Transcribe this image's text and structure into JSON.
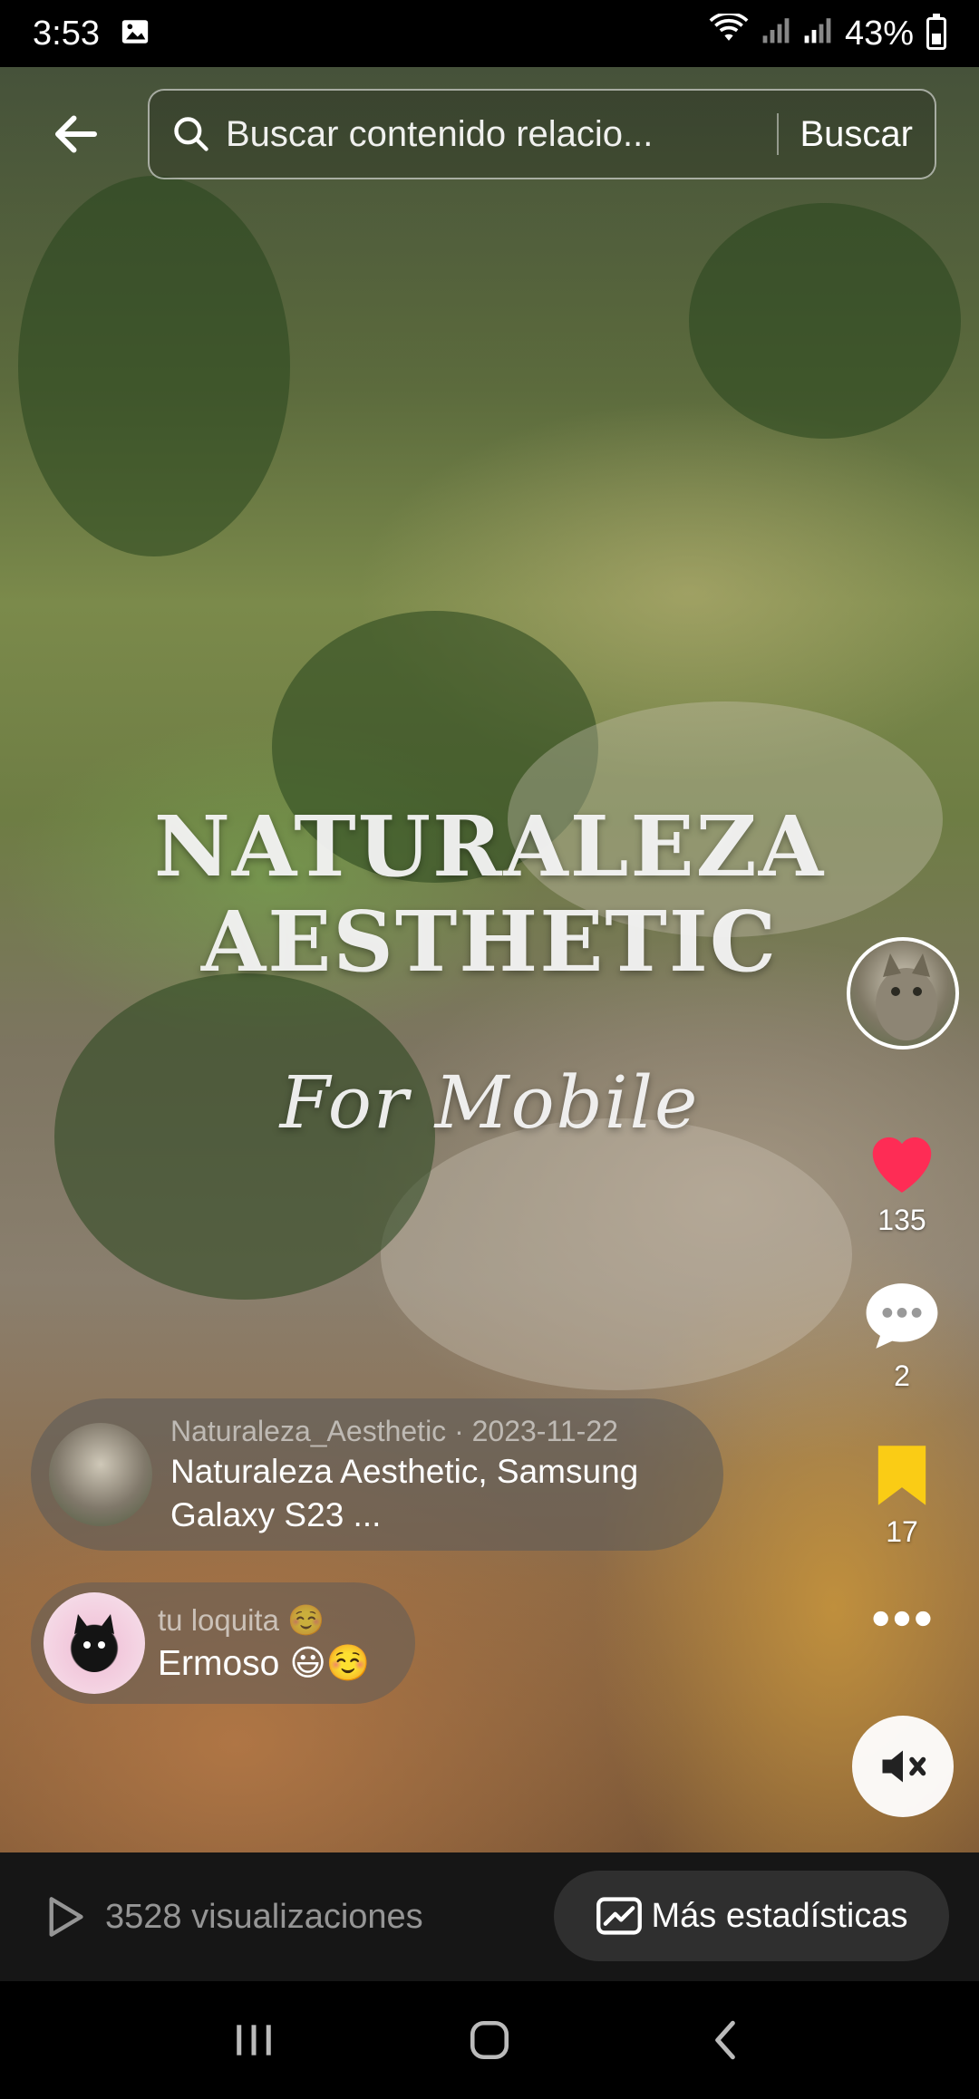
{
  "status_bar": {
    "time": "3:53",
    "battery": "43%"
  },
  "search": {
    "placeholder": "Buscar contenido relacio...",
    "button_label": "Buscar"
  },
  "video": {
    "title_line1": "NATURALEZA",
    "title_line2": "AESTHETIC",
    "title_line3": "For Mobile"
  },
  "rail": {
    "likes": "135",
    "comments": "2",
    "saves": "17",
    "like_color": "#fe2c55",
    "save_color": "#facc15"
  },
  "caption": {
    "meta": "Naturaleza_Aesthetic · 2023-11-22",
    "text_line1": "Naturaleza Aesthetic, Samsung",
    "text_line2": "Galaxy S23 ..."
  },
  "comment": {
    "author": "tu loquita ☺️",
    "text": "Ermoso 😃☺️"
  },
  "bottom": {
    "views": "3528 visualizaciones",
    "stats_label": "Más estadísticas"
  }
}
